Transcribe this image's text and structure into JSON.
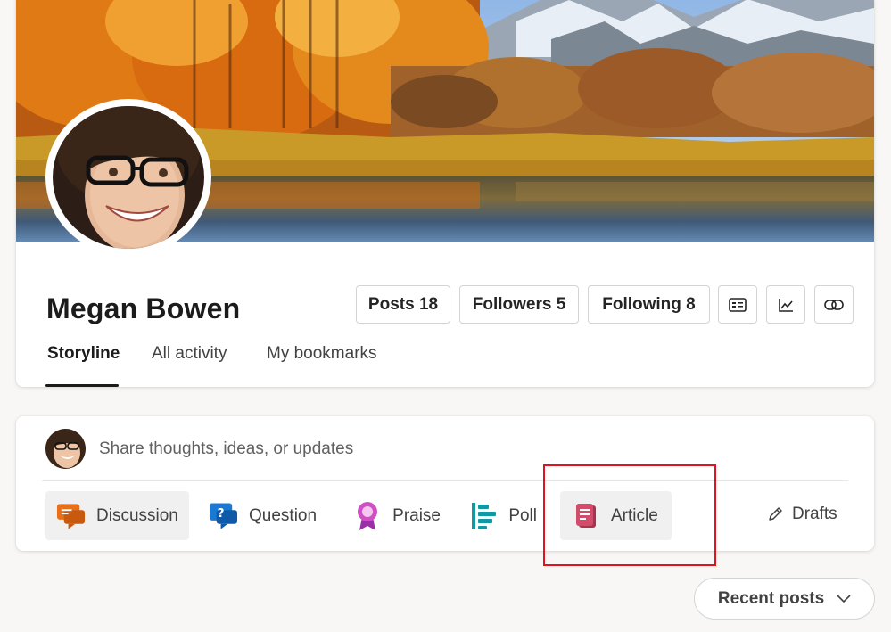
{
  "profile": {
    "name": "Megan Bowen",
    "cover_image": "autumn-lake-mountains",
    "avatar_image": "megan-bowen-portrait"
  },
  "stats": {
    "posts_label": "Posts 18",
    "followers_label": "Followers 5",
    "following_label": "Following 8"
  },
  "actions": {
    "contact_card": "contact-card-icon",
    "analytics": "trend-chart-icon",
    "copy_link": "link-icon"
  },
  "tabs": [
    {
      "label": "Storyline",
      "active": true
    },
    {
      "label": "All activity",
      "active": false
    },
    {
      "label": "My bookmarks",
      "active": false
    }
  ],
  "composer": {
    "placeholder": "Share thoughts, ideas, or updates",
    "post_types": [
      {
        "label": "Discussion",
        "icon": "discussion-icon",
        "color": "#e8701a"
      },
      {
        "label": "Question",
        "icon": "question-icon",
        "color": "#1b79d4"
      },
      {
        "label": "Praise",
        "icon": "praise-icon",
        "color": "#c239b3"
      },
      {
        "label": "Poll",
        "icon": "poll-icon",
        "color": "#0f9aa3"
      },
      {
        "label": "Article",
        "icon": "article-icon",
        "color": "#d24d6a"
      }
    ],
    "drafts_label": "Drafts"
  },
  "feed": {
    "sort_label": "Recent posts"
  },
  "colors": {
    "annotation": "#e0141e",
    "page_bg": "#f8f7f5"
  }
}
